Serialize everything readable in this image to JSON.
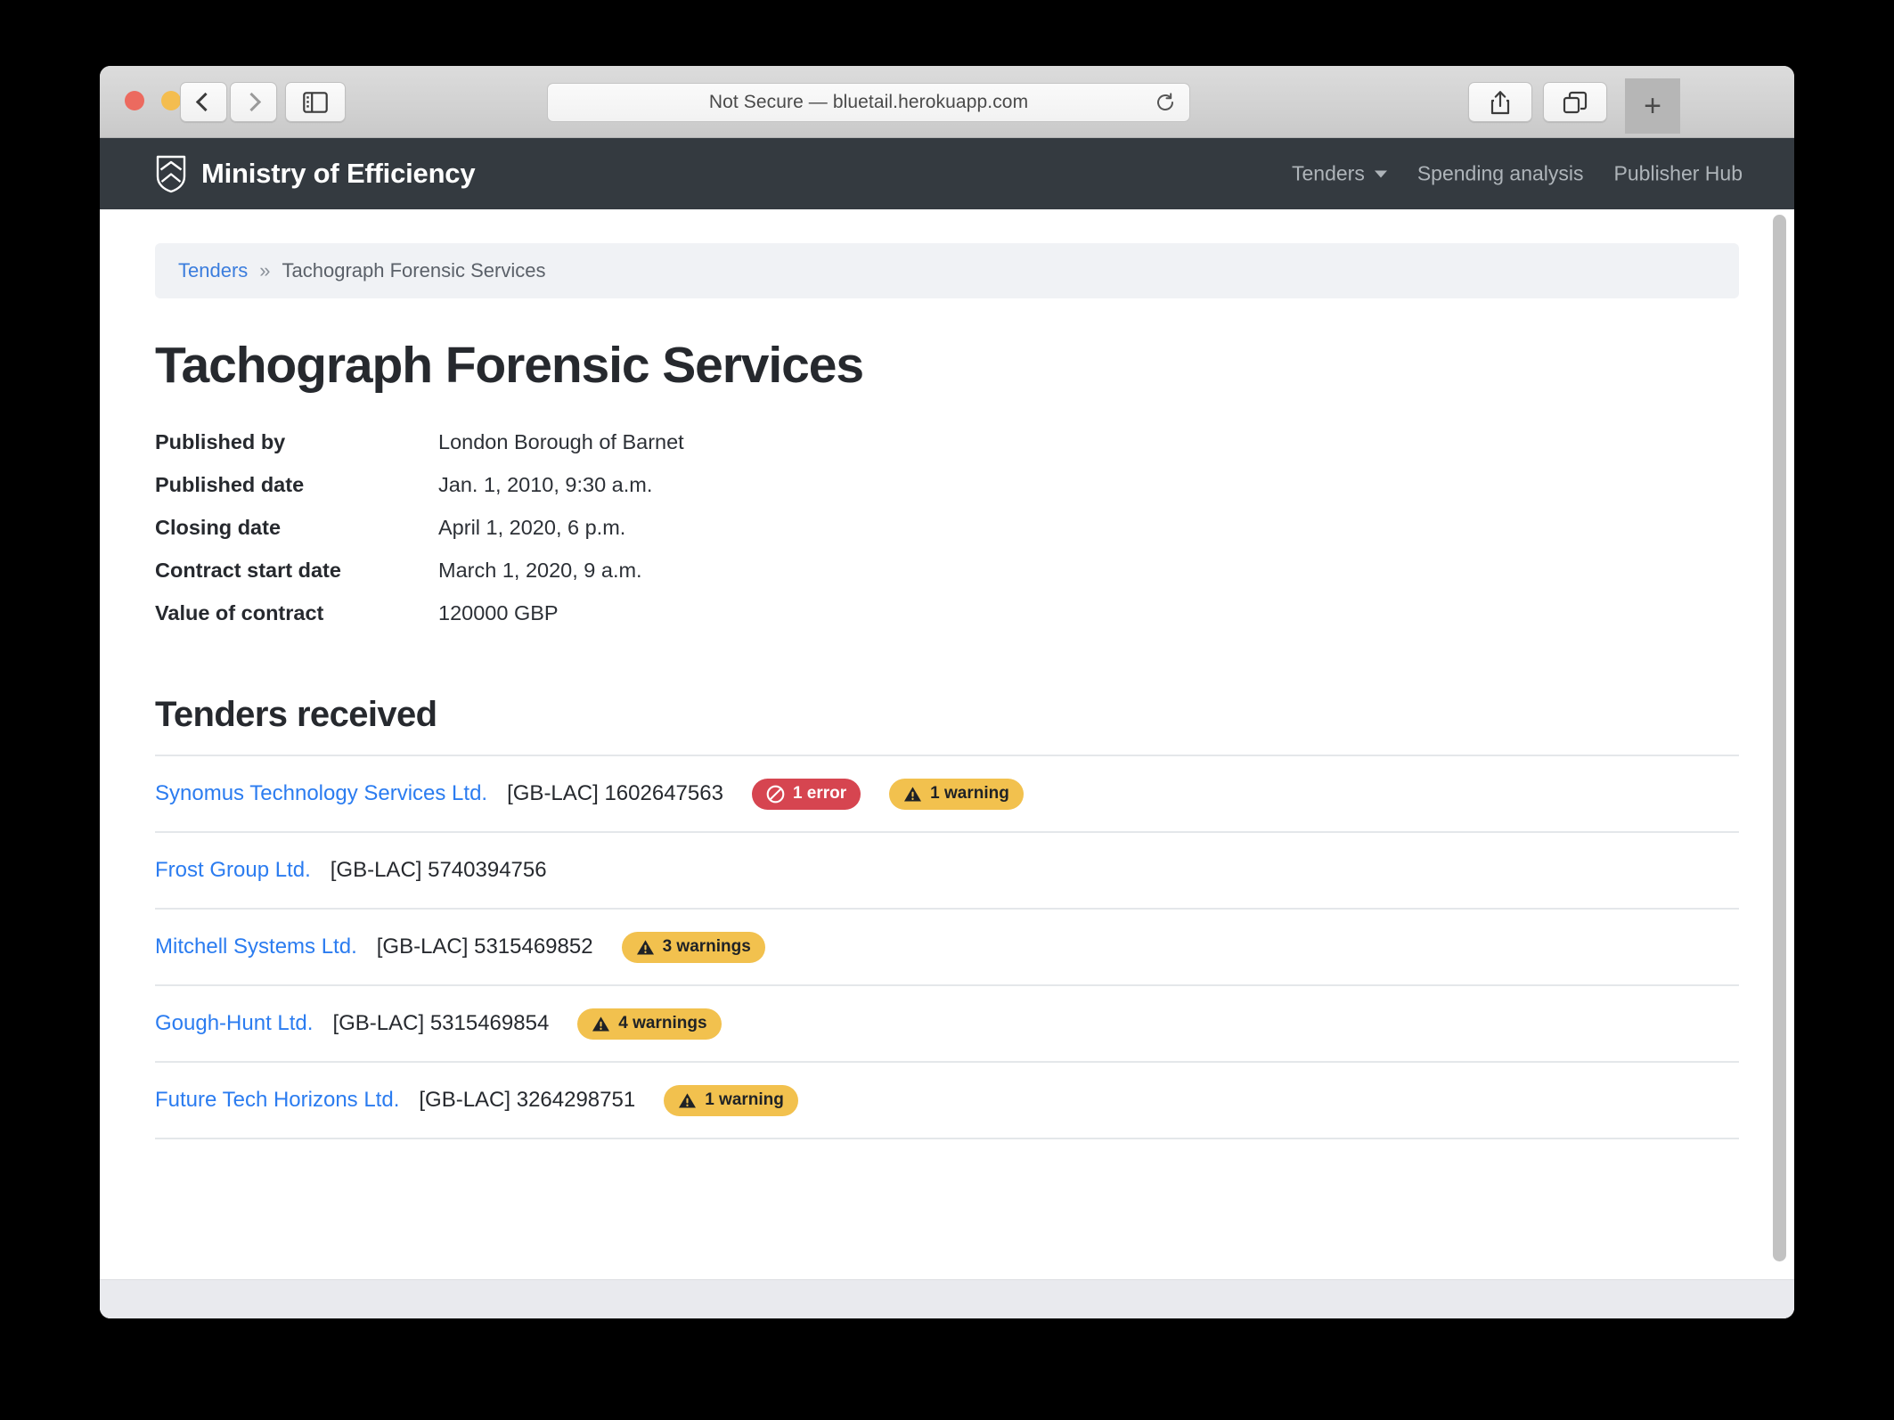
{
  "browser": {
    "address": "Not Secure — bluetail.herokuapp.com",
    "back_label": "Back",
    "forward_label": "Forward",
    "sidebar_label": "Show sidebar",
    "share_label": "Share",
    "tabs_label": "Show tab overview",
    "new_tab_label": "+",
    "reload_label": "Reload"
  },
  "site": {
    "brand": "Ministry of Efficiency",
    "nav": [
      {
        "label": "Tenders",
        "has_caret": true
      },
      {
        "label": "Spending analysis",
        "has_caret": false
      },
      {
        "label": "Publisher Hub",
        "has_caret": false
      }
    ]
  },
  "breadcrumb": {
    "link": "Tenders",
    "separator": "»",
    "current": "Tachograph Forensic Services"
  },
  "page": {
    "title": "Tachograph Forensic Services",
    "details": [
      {
        "label": "Published by",
        "value": "London Borough of Barnet"
      },
      {
        "label": "Published date",
        "value": "Jan. 1, 2010, 9:30 a.m."
      },
      {
        "label": "Closing date",
        "value": "April 1, 2020, 6 p.m."
      },
      {
        "label": "Contract start date",
        "value": "March 1, 2020, 9 a.m."
      },
      {
        "label": "Value of contract",
        "value": "120000 GBP"
      }
    ],
    "tenders_heading": "Tenders received",
    "tenders": [
      {
        "name": "Synomus Technology Services Ltd.",
        "id": "[GB-LAC] 1602647563",
        "badges": [
          {
            "type": "error",
            "label": "1 error"
          },
          {
            "type": "warning",
            "label": "1 warning"
          }
        ]
      },
      {
        "name": "Frost Group Ltd.",
        "id": "[GB-LAC] 5740394756",
        "badges": []
      },
      {
        "name": "Mitchell Systems Ltd.",
        "id": "[GB-LAC] 5315469852",
        "badges": [
          {
            "type": "warning",
            "label": "3 warnings"
          }
        ]
      },
      {
        "name": "Gough-Hunt Ltd.",
        "id": "[GB-LAC] 5315469854",
        "badges": [
          {
            "type": "warning",
            "label": "4 warnings"
          }
        ]
      },
      {
        "name": "Future Tech Horizons Ltd.",
        "id": "[GB-LAC] 3264298751",
        "badges": [
          {
            "type": "warning",
            "label": "1 warning"
          }
        ]
      }
    ]
  },
  "colors": {
    "header_bg": "#343a40",
    "link": "#2b7cf0",
    "breadcrumb_link": "#3b7ddd",
    "error_badge": "#d64550",
    "warning_badge": "#f2c14e",
    "text": "#26292e"
  }
}
